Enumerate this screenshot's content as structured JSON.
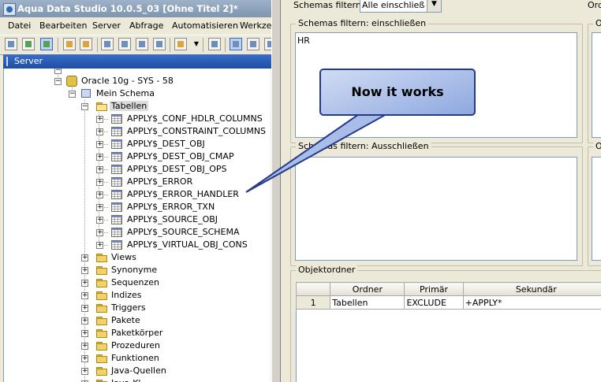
{
  "window": {
    "title": "Aqua Data Studio 10.0.5_03 [Ohne Titel 2]*"
  },
  "menubar": [
    "Datei",
    "Bearbeiten",
    "Server",
    "Abfrage",
    "Automatisieren",
    "Werkzeu"
  ],
  "server_panel": {
    "title": "Server"
  },
  "tree": {
    "connection": "Oracle 10g - SYS - 58",
    "schema": "Mein Schema",
    "tables_folder": "Tabellen",
    "tables": [
      "APPLY$_CONF_HDLR_COLUMNS",
      "APPLY$_CONSTRAINT_COLUMNS",
      "APPLY$_DEST_OBJ",
      "APPLY$_DEST_OBJ_CMAP",
      "APPLY$_DEST_OBJ_OPS",
      "APPLY$_ERROR",
      "APPLY$_ERROR_HANDLER",
      "APPLY$_ERROR_TXN",
      "APPLY$_SOURCE_OBJ",
      "APPLY$_SOURCE_SCHEMA",
      "APPLY$_VIRTUAL_OBJ_CONS"
    ],
    "folders": [
      "Views",
      "Synonyme",
      "Sequenzen",
      "Indizes",
      "Triggers",
      "Pakete",
      "Paketkörper",
      "Prozeduren",
      "Funktionen",
      "Java-Quellen",
      "Java-Kl..."
    ]
  },
  "filter": {
    "label": "Schemas filtern:",
    "value": "Alle einschließen",
    "right_label": "Ord"
  },
  "include_box": {
    "legend": "Schemas filtern: einschließen",
    "content": "HR"
  },
  "exclude_box": {
    "legend": "Schemas filtern: Ausschließen",
    "content": ""
  },
  "right_legend_1": "O",
  "right_legend_2": "O",
  "folder_section": {
    "legend": "Objektordner",
    "columns": [
      "Ordner",
      "Primär",
      "Sekundär"
    ],
    "rows": [
      {
        "num": "1",
        "ordner": "Tabellen",
        "primaer": "EXCLUDE",
        "sekundaer": "+APPLY*"
      }
    ]
  },
  "callout": {
    "text": "Now it works"
  }
}
